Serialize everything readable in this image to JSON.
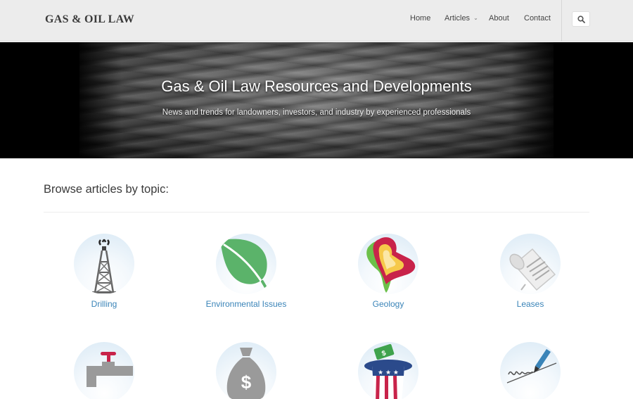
{
  "header": {
    "logo": "GAS & OIL LAW",
    "nav": [
      {
        "label": "Home"
      },
      {
        "label": "Articles",
        "has_dropdown": true
      },
      {
        "label": "About"
      },
      {
        "label": "Contact"
      }
    ],
    "search_icon": "search-icon"
  },
  "hero": {
    "title": "Gas & Oil Law Resources and Developments",
    "subtitle": "News and trends for landowners, investors, and industry by experienced professionals"
  },
  "main": {
    "section_title": "Browse articles by topic:",
    "topics": [
      {
        "label": "Drilling",
        "icon": "oil-derrick-icon"
      },
      {
        "label": "Environmental Issues",
        "icon": "leaf-icon"
      },
      {
        "label": "Geology",
        "icon": "map-heart-icon"
      },
      {
        "label": "Leases",
        "icon": "scroll-icon"
      },
      {
        "label": "",
        "icon": "water-faucet-icon"
      },
      {
        "label": "",
        "icon": "money-bag-icon"
      },
      {
        "label": "",
        "icon": "uncle-sam-hat-icon"
      },
      {
        "label": "",
        "icon": "signature-pen-icon"
      }
    ]
  },
  "colors": {
    "link": "#3a84b8",
    "header_bg": "#ececec",
    "leaf_green": "#5bb36a",
    "accent_red": "#c8234a"
  }
}
